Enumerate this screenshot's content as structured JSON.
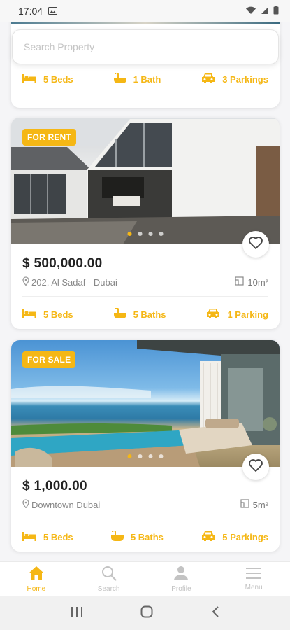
{
  "status": {
    "time": "17:04"
  },
  "search": {
    "placeholder": "Search Property"
  },
  "colors": {
    "accent": "#f5b715",
    "nav_inactive": "#c3c3c3",
    "background": "#f5f5f7"
  },
  "listings": [
    {
      "features": [
        {
          "icon": "bed-icon",
          "label": "5 Beds"
        },
        {
          "icon": "bathtub-icon",
          "label": "1 Bath"
        },
        {
          "icon": "car-icon",
          "label": "3 Parkings"
        }
      ]
    },
    {
      "badge": "FOR RENT",
      "price": "$ 500,000.00",
      "location": "202, Al Sadaf - Dubai",
      "area": "10m²",
      "carousel": {
        "active_index": 0,
        "count": 4
      },
      "features": [
        {
          "icon": "bed-icon",
          "label": "5 Beds"
        },
        {
          "icon": "bathtub-icon",
          "label": "5 Baths"
        },
        {
          "icon": "car-icon",
          "label": "1 Parking"
        }
      ]
    },
    {
      "badge": "FOR SALE",
      "price": "$ 1,000.00",
      "location": "Downtown Dubai",
      "area": "5m²",
      "carousel": {
        "active_index": 0,
        "count": 4
      },
      "features": [
        {
          "icon": "bed-icon",
          "label": "5 Beds"
        },
        {
          "icon": "bathtub-icon",
          "label": "5 Baths"
        },
        {
          "icon": "car-icon",
          "label": "5 Parkings"
        }
      ]
    }
  ],
  "nav": [
    {
      "label": "Home",
      "icon": "home-icon",
      "active": true
    },
    {
      "label": "Search",
      "icon": "search-icon",
      "active": false
    },
    {
      "label": "Profile",
      "icon": "user-icon",
      "active": false
    },
    {
      "label": "Menu",
      "icon": "menu-icon",
      "active": false
    }
  ]
}
